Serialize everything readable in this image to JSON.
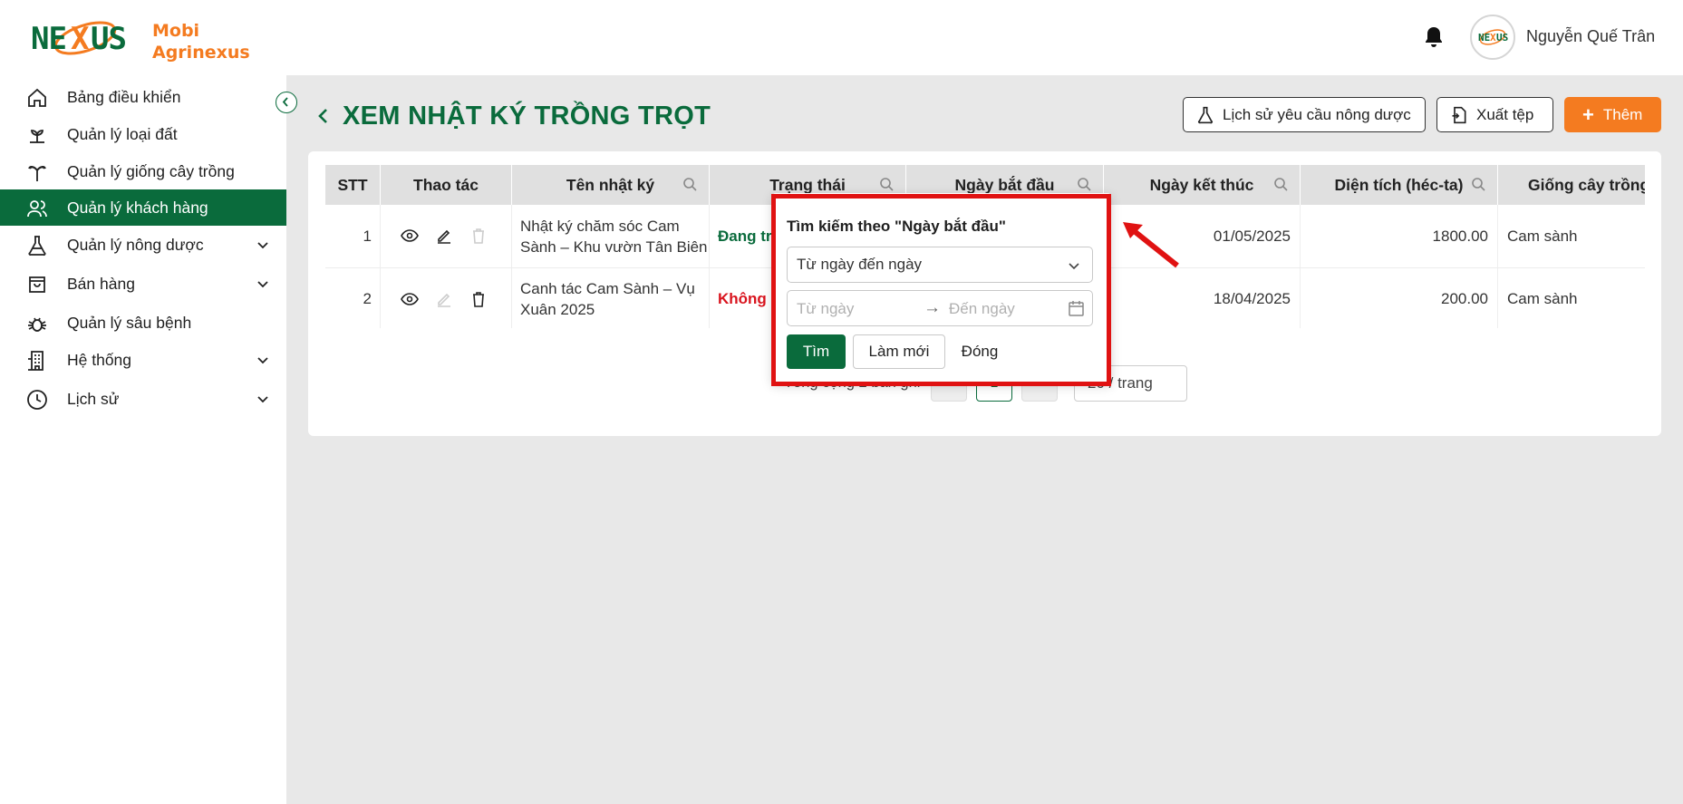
{
  "header": {
    "brand_line1": "Mobi",
    "brand_line2": "Agrinexus",
    "logo_text": "NEXUS",
    "user_name": "Nguyễn Quế Trân",
    "notification_icon": "bell-icon"
  },
  "sidebar": {
    "items": [
      {
        "label": "Bảng điều khiển",
        "icon": "home-icon"
      },
      {
        "label": "Quản lý loại đất",
        "icon": "soil-icon"
      },
      {
        "label": "Quản lý giống cây trồng",
        "icon": "palm-tree-icon"
      },
      {
        "label": "Quản lý khách hàng",
        "icon": "users-icon",
        "active": true
      },
      {
        "label": "Quản lý nông dược",
        "icon": "flask-icon",
        "expandable": true
      },
      {
        "label": "Bán hàng",
        "icon": "shopping-bag-icon",
        "expandable": true
      },
      {
        "label": "Quản lý sâu bệnh",
        "icon": "bug-icon"
      },
      {
        "label": "Hệ thống",
        "icon": "building-icon",
        "expandable": true
      },
      {
        "label": "Lịch sử",
        "icon": "clock-icon",
        "expandable": true
      }
    ]
  },
  "page": {
    "title": "XEM NHẬT KÝ TRỒNG TRỌT",
    "btn_history": "Lịch sử yêu cầu nông dược",
    "btn_export": "Xuất tệp",
    "btn_add": "Thêm"
  },
  "table": {
    "columns": [
      "STT",
      "Thao tác",
      "Tên nhật ký",
      "Trạng thái",
      "Ngày bắt đầu",
      "Ngày kết thúc",
      "Diện tích (héc-ta)",
      "Giống cây trồng"
    ],
    "rows": [
      {
        "stt": "1",
        "name_line1": "Nhật ký chăm sóc Cam",
        "name_line2": "Sành – Khu vườn Tân Biên",
        "status": "Đang tr",
        "end_date": "01/05/2025",
        "area": "1800.00",
        "variety": "Cam sành"
      },
      {
        "stt": "2",
        "name_line1": "Canh tác Cam Sành – Vụ",
        "name_line2": "Xuân 2025",
        "status": "Không :",
        "end_date": "18/04/2025",
        "area": "200.00",
        "variety": "Cam sành"
      }
    ]
  },
  "pagination": {
    "total_text": "Tổng cộng 2 bản ghi",
    "current_page": "1",
    "page_size": "20 / trang"
  },
  "filter_popup": {
    "title": "Tìm kiếm theo \"Ngày bắt đầu\"",
    "mode": "Từ ngày đến ngày",
    "from_placeholder": "Từ ngày",
    "to_placeholder": "Đến ngày",
    "btn_find": "Tìm",
    "btn_reset": "Làm mới",
    "btn_close": "Đóng"
  },
  "colors": {
    "primary_green": "#0a6b3c",
    "accent_orange": "#f47b20",
    "status_red": "#d9141e",
    "highlight_red": "#e01212"
  }
}
